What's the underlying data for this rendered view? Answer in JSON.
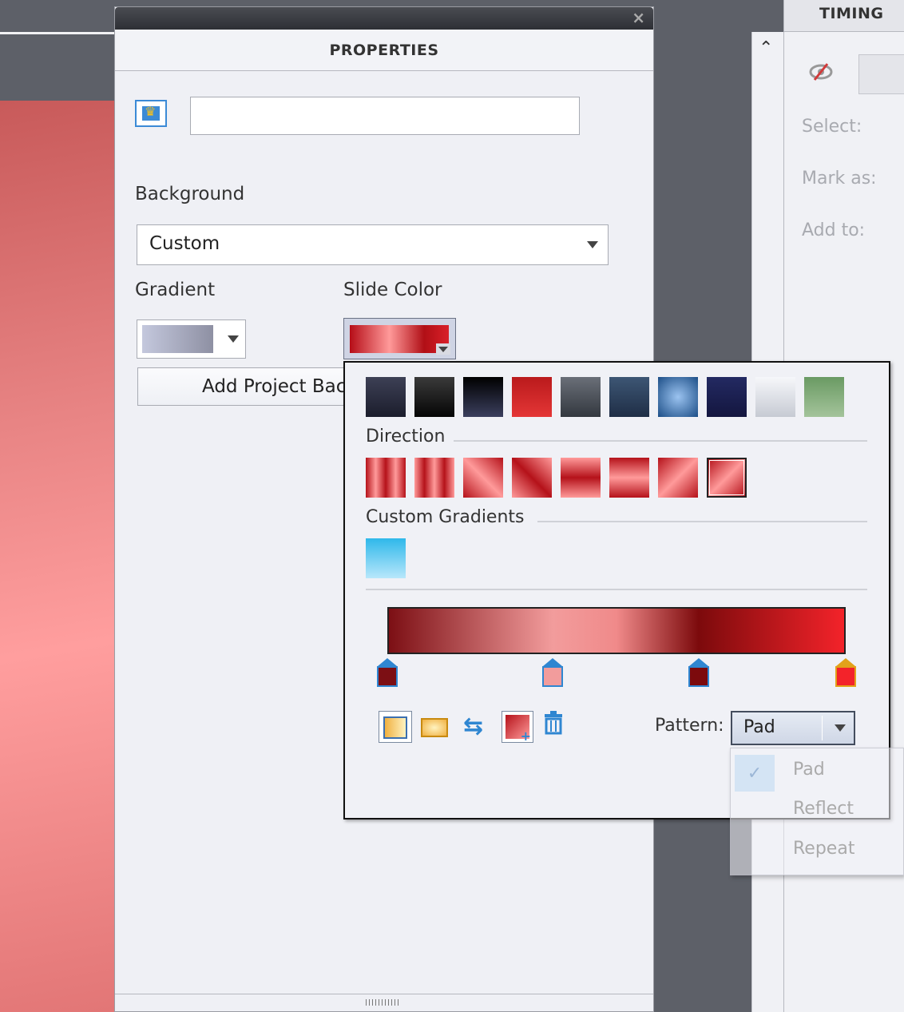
{
  "panels": {
    "properties_title": "PROPERTIES",
    "timing_title": "TIMING",
    "close_glyph": "×"
  },
  "properties": {
    "name_value": "",
    "background_label": "Background",
    "background_value": "Custom",
    "gradient_label": "Gradient",
    "slide_color_label": "Slide Color",
    "add_project_background_label": "Add Project Bac"
  },
  "timing": {
    "select_label": "Select:",
    "mark_as_label": "Mark as:",
    "add_to_label": "Add to:"
  },
  "gradient_popup": {
    "direction_title": "Direction",
    "custom_gradients_title": "Custom Gradients",
    "pattern_label": "Pattern:",
    "pattern_value": "Pad",
    "presets": [
      {
        "name": "dark-slate",
        "from": "#3d4055",
        "to": "#1b1d2c"
      },
      {
        "name": "black",
        "from": "#3a3a3a",
        "to": "#050505"
      },
      {
        "name": "midnight",
        "from": "#000000",
        "to": "#3b3f5e"
      },
      {
        "name": "red",
        "from": "#ba1a1c",
        "to": "#e43636"
      },
      {
        "name": "charcoal",
        "from": "#6a6f78",
        "to": "#33383f"
      },
      {
        "name": "navy-steel",
        "from": "#3d5674",
        "to": "#1f2e46"
      },
      {
        "name": "blue-glow",
        "from": "#9bc3f0",
        "to": "#1c4e87"
      },
      {
        "name": "indigo",
        "from": "#232a62",
        "to": "#14163f"
      },
      {
        "name": "silver",
        "from": "#f6f7fa",
        "to": "#c6cad3"
      },
      {
        "name": "sage",
        "from": "#6a9a63",
        "to": "#a4c49b"
      }
    ],
    "stops": [
      {
        "position": 0.0,
        "color": "#7c0f14"
      },
      {
        "position": 0.36,
        "color": "#f29c9c"
      },
      {
        "position": 0.68,
        "color": "#7c0a0c"
      },
      {
        "position": 1.0,
        "color": "#f3232a"
      }
    ],
    "pattern_options": [
      "Pad",
      "Reflect",
      "Repeat"
    ],
    "selected_direction_index": 7
  },
  "colors": {
    "accent": "#2f86d1",
    "slide_gradient": [
      "#b60d17",
      "#ff9a9a",
      "#d92029"
    ]
  }
}
